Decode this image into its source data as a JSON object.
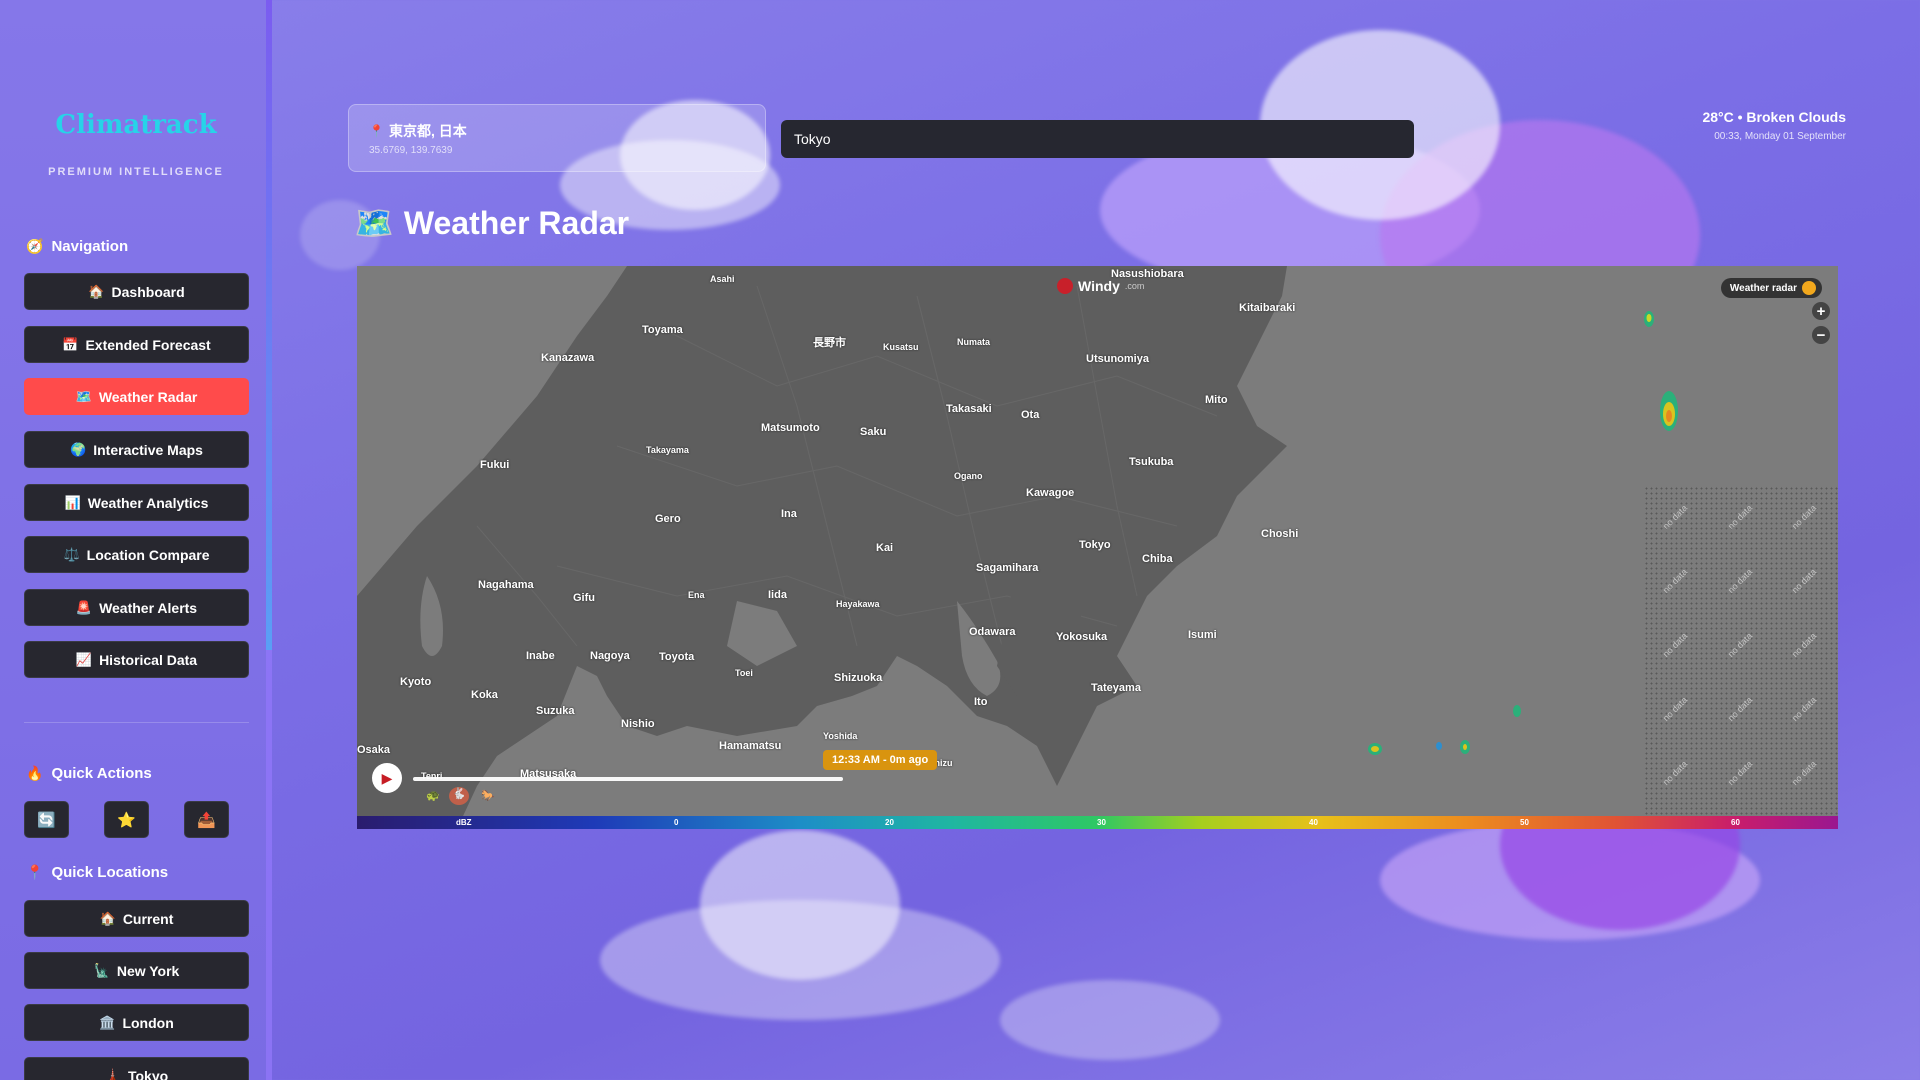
{
  "brand": {
    "name": "Climatrack",
    "tagline": "PREMIUM INTELLIGENCE"
  },
  "sidebar": {
    "navigation_title": "Navigation",
    "nav_items": [
      {
        "label": "Dashboard",
        "icon": "🏠"
      },
      {
        "label": "Extended Forecast",
        "icon": "📅"
      },
      {
        "label": "Weather Radar",
        "icon": "🗺️",
        "active": true
      },
      {
        "label": "Interactive Maps",
        "icon": "🌍"
      },
      {
        "label": "Weather Analytics",
        "icon": "📊"
      },
      {
        "label": "Location Compare",
        "icon": "⚖️"
      },
      {
        "label": "Weather Alerts",
        "icon": "🚨"
      },
      {
        "label": "Historical Data",
        "icon": "📈"
      }
    ],
    "quick_actions_title": "Quick Actions",
    "quick_actions": [
      {
        "icon": "🔄",
        "name": "refresh"
      },
      {
        "icon": "⭐",
        "name": "favorite"
      },
      {
        "icon": "📤",
        "name": "share"
      }
    ],
    "quick_locations_title": "Quick Locations",
    "quick_locations": [
      {
        "label": "Current",
        "icon": "🏠"
      },
      {
        "label": "New York",
        "icon": "🗽"
      },
      {
        "label": "London",
        "icon": "🏛️"
      },
      {
        "label": "Tokyo",
        "icon": "🗼"
      }
    ]
  },
  "header": {
    "location_name": "東京都, 日本",
    "location_coords": "35.6769, 139.7639",
    "search_value": "Tokyo",
    "current_weather": "28°C • Broken Clouds",
    "current_datetime": "00:33, Monday 01 September"
  },
  "page": {
    "title": "Weather Radar",
    "title_icon": "🗺️"
  },
  "radar": {
    "provider": "Windy",
    "provider_suffix": ".com",
    "layer_label": "Weather radar",
    "time_label": "12:33 AM - 0m ago",
    "scale_unit": "dBZ",
    "scale_ticks": [
      "0",
      "20",
      "30",
      "40",
      "50",
      "60"
    ],
    "no_data_label": "no data",
    "cities": [
      {
        "name": "Nasushiobara"
      },
      {
        "name": "Asahi"
      },
      {
        "name": "Kitaibaraki"
      },
      {
        "name": "Toyama"
      },
      {
        "name": "長野市"
      },
      {
        "name": "Kusatsu"
      },
      {
        "name": "Numata"
      },
      {
        "name": "Kanazawa"
      },
      {
        "name": "Utsunomiya"
      },
      {
        "name": "Mito"
      },
      {
        "name": "Takasaki"
      },
      {
        "name": "Ota"
      },
      {
        "name": "Matsumoto"
      },
      {
        "name": "Saku"
      },
      {
        "name": "Takayama"
      },
      {
        "name": "Fukui"
      },
      {
        "name": "Tsukuba"
      },
      {
        "name": "Ogano"
      },
      {
        "name": "Kawagoe"
      },
      {
        "name": "Gero"
      },
      {
        "name": "Ina"
      },
      {
        "name": "Choshi"
      },
      {
        "name": "Kai"
      },
      {
        "name": "Tokyo"
      },
      {
        "name": "Chiba"
      },
      {
        "name": "Sagamihara"
      },
      {
        "name": "Nagahama"
      },
      {
        "name": "Gifu"
      },
      {
        "name": "Ena"
      },
      {
        "name": "Iida"
      },
      {
        "name": "Hayakawa"
      },
      {
        "name": "Odawara"
      },
      {
        "name": "Yokosuka"
      },
      {
        "name": "Isumi"
      },
      {
        "name": "Inabe"
      },
      {
        "name": "Nagoya"
      },
      {
        "name": "Toyota"
      },
      {
        "name": "Toei"
      },
      {
        "name": "Shizuoka"
      },
      {
        "name": "Kyoto"
      },
      {
        "name": "Koka"
      },
      {
        "name": "Tateyama"
      },
      {
        "name": "Suzuka"
      },
      {
        "name": "Ito"
      },
      {
        "name": "Nishio"
      },
      {
        "name": "Hamamatsu"
      },
      {
        "name": "Yoshida"
      },
      {
        "name": "Osaka"
      },
      {
        "name": "Matsusaka"
      },
      {
        "name": "Shimizu"
      },
      {
        "name": "Tenri"
      }
    ],
    "speed_options": [
      "slow",
      "normal",
      "fast"
    ]
  }
}
